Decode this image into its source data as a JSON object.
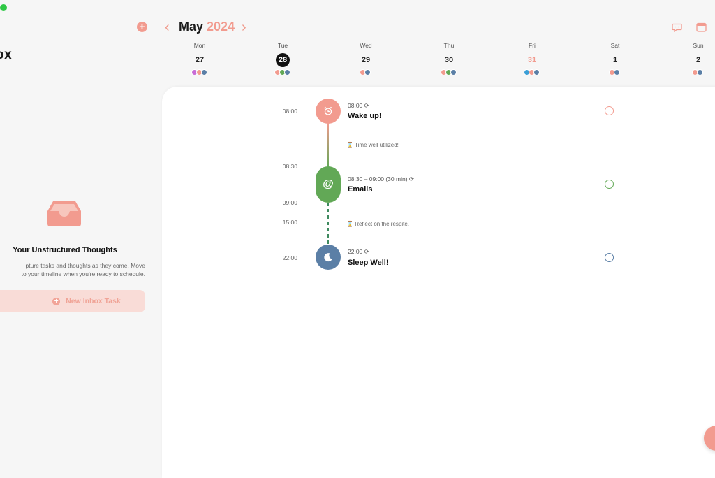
{
  "sidebar": {
    "title": "ox",
    "add_icon": "plus-circle-icon",
    "empty_state": {
      "icon": "inbox-tray-icon",
      "title": "Your Unstructured Thoughts",
      "line1": "pture tasks and thoughts as they come. Move",
      "line2": "to your timeline when you're ready to schedule."
    },
    "new_button": "New Inbox Task"
  },
  "header": {
    "month": "May",
    "year": "2024",
    "prev_icon": "chevron-left-icon",
    "next_icon": "chevron-right-icon",
    "tools": [
      "chat-icon",
      "calendar-icon"
    ]
  },
  "week": [
    {
      "name": "Mon",
      "date": "27",
      "dots": [
        "#c86bd6",
        "#f29b8f",
        "#5b7fa6"
      ]
    },
    {
      "name": "Tue",
      "date": "28",
      "today": true,
      "dots": [
        "#f29b8f",
        "#62a856",
        "#5b7fa6"
      ]
    },
    {
      "name": "Wed",
      "date": "29",
      "dots": [
        "#f29b8f",
        "#5b7fa6"
      ]
    },
    {
      "name": "Thu",
      "date": "30",
      "dots": [
        "#f29b8f",
        "#62a856",
        "#5b7fa6"
      ]
    },
    {
      "name": "Fri",
      "date": "31",
      "dots": [
        "#3b9fd6",
        "#f29b8f",
        "#5b7fa6"
      ]
    },
    {
      "name": "Sat",
      "date": "1",
      "dots": [
        "#f29b8f",
        "#5b7fa6"
      ]
    },
    {
      "name": "Sun",
      "date": "2",
      "dots": [
        "#f29b8f",
        "#5b7fa6"
      ]
    }
  ],
  "timeline": {
    "times": [
      "08:00",
      "08:30",
      "09:00",
      "15:00",
      "22:00"
    ],
    "tasks": [
      {
        "meta": "08:00",
        "title": "Wake up!",
        "color": "#f29b8f",
        "icon": "alarm-clock-icon"
      },
      {
        "meta": "08:30 – 09:00 (30 min)",
        "title": "Emails",
        "color": "#62a856",
        "icon": "at-sign-icon",
        "glyph": "@"
      },
      {
        "meta": "22:00",
        "title": "Sleep Well!",
        "color": "#5b7fa6",
        "icon": "moon-icon"
      }
    ],
    "gaps": [
      "Time well utilized!",
      "Reflect on the respite."
    ]
  },
  "colors": {
    "accent": "#f29b8f",
    "green": "#62a856",
    "blue": "#5b7fa6"
  }
}
